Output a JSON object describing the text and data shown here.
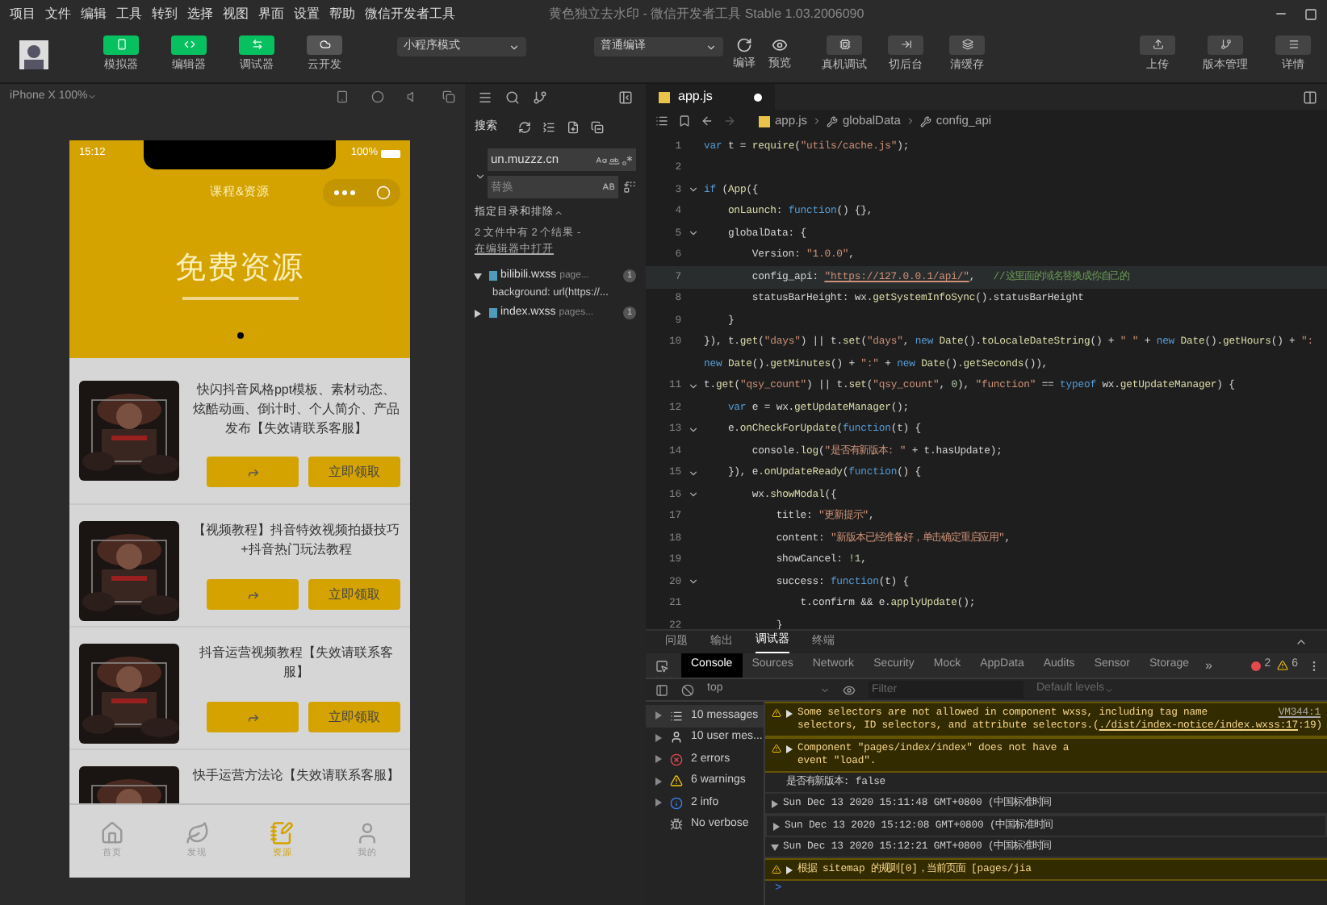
{
  "menu": [
    "项目",
    "文件",
    "编辑",
    "工具",
    "转到",
    "选择",
    "视图",
    "界面",
    "设置",
    "帮助",
    "微信开发者工具"
  ],
  "window": {
    "title": "黄色独立去水印 - 微信开发者工具 Stable 1.03.2006090"
  },
  "toolbar": {
    "views": [
      {
        "label": "模拟器",
        "kind": "phone",
        "on": true
      },
      {
        "label": "编辑器",
        "kind": "code",
        "on": true
      },
      {
        "label": "调试器",
        "kind": "debug",
        "on": true
      },
      {
        "label": "云开发",
        "kind": "cloud",
        "on": false
      }
    ],
    "mode": "小程序模式",
    "compile": "普通编译",
    "actions": [
      {
        "label": "编译",
        "kind": "refresh"
      },
      {
        "label": "预览",
        "kind": "eye"
      }
    ],
    "tools": [
      {
        "label": "真机调试",
        "kind": "device"
      },
      {
        "label": "切后台",
        "kind": "background"
      },
      {
        "label": "清缓存",
        "kind": "cache"
      }
    ],
    "right": [
      {
        "label": "上传",
        "kind": "upload"
      },
      {
        "label": "版本管理",
        "kind": "branch"
      },
      {
        "label": "详情",
        "kind": "details"
      }
    ]
  },
  "simulator": {
    "device": "iPhone X 100%",
    "time": "15:12",
    "battery": "100%",
    "nav_title": "课程&资源",
    "banner_title": "免费资源",
    "items": [
      {
        "title": "快闪抖音风格ppt模板、素材动态、炫酷动画、倒计时、个人简介、产品发布【失效请联系客服】",
        "button": "立即领取"
      },
      {
        "title": "【视频教程】抖音特效视频拍摄技巧+抖音热门玩法教程",
        "button": "立即领取"
      },
      {
        "title": "抖音运营视频教程【失效请联系客服】",
        "button": "立即领取"
      },
      {
        "title": "快手运营方法论【失效请联系客服】"
      }
    ],
    "tabs": [
      {
        "label": "首页",
        "kind": "home",
        "selected": false
      },
      {
        "label": "发现",
        "kind": "discover",
        "selected": false
      },
      {
        "label": "资源",
        "kind": "resource",
        "selected": true
      },
      {
        "label": "我的",
        "kind": "me",
        "selected": false
      }
    ]
  },
  "search": {
    "title": "搜索",
    "query": "un.muzzz.cn",
    "replace_placeholder": "替换",
    "scope": "指定目录和排除",
    "summary": "2 文件中有 2 个结果 - ",
    "open_link": "在编辑器中打开",
    "results": [
      {
        "file": "bilibili.wxss",
        "path": "page...",
        "count": "1",
        "expanded": true,
        "children": [
          {
            "text": "background: url(https://..."
          }
        ]
      },
      {
        "file": "index.wxss",
        "path": "pages...",
        "count": "1",
        "expanded": false
      }
    ]
  },
  "editor": {
    "tab": "app.js",
    "modified": true,
    "breadcrumb": [
      "app.js",
      "globalData",
      "config_api"
    ],
    "lines": [
      {
        "n": "1",
        "fold": false,
        "current": false,
        "tokens": [
          {
            "text": "var ",
            "kind": "kw"
          },
          {
            "text": "t = ",
            "kind": "p"
          },
          {
            "text": "require",
            "kind": "fn"
          },
          {
            "text": "(",
            "kind": "p"
          },
          {
            "text": "\"utils/cache.js\"",
            "kind": "str"
          },
          {
            "text": ");",
            "kind": "p"
          }
        ]
      },
      {
        "n": "2",
        "fold": false,
        "current": false
      },
      {
        "n": "3",
        "fold": true,
        "current": false,
        "tokens": [
          {
            "text": "if ",
            "kind": "kw"
          },
          {
            "text": "(",
            "kind": "p"
          },
          {
            "text": "App",
            "kind": "fn"
          },
          {
            "text": "({",
            "kind": "p"
          }
        ]
      },
      {
        "n": "4",
        "fold": false,
        "current": false,
        "tokens": [
          {
            "text": "    onLaunch",
            "kind": "fn"
          },
          {
            "text": ": ",
            "kind": "p"
          },
          {
            "text": "function",
            "kind": "kw"
          },
          {
            "text": "() {},",
            "kind": "p"
          }
        ]
      },
      {
        "n": "5",
        "fold": true,
        "current": false,
        "tokens": [
          {
            "text": "    globalData: {",
            "kind": "p"
          }
        ]
      },
      {
        "n": "6",
        "fold": false,
        "current": false,
        "tokens": [
          {
            "text": "        Version: ",
            "kind": "p"
          },
          {
            "text": "\"1.0.0\"",
            "kind": "str"
          },
          {
            "text": ",",
            "kind": "p"
          }
        ]
      },
      {
        "n": "7",
        "fold": false,
        "current": true,
        "tokens": [
          {
            "text": "        config_api: ",
            "kind": "p"
          },
          {
            "text": "\"https://127.0.0.1/api/\"",
            "kind": "url"
          },
          {
            "text": ",   ",
            "kind": "p"
          },
          {
            "text": "//这里面的域名替换成你自己的",
            "kind": "cmt"
          }
        ]
      },
      {
        "n": "8",
        "fold": false,
        "current": false,
        "tokens": [
          {
            "text": "        statusBarHeight: wx.",
            "kind": "p"
          },
          {
            "text": "getSystemInfoSync",
            "kind": "fn"
          },
          {
            "text": "().statusBarHeight",
            "kind": "p"
          }
        ]
      },
      {
        "n": "9",
        "fold": false,
        "current": false,
        "tokens": [
          {
            "text": "    }",
            "kind": "p"
          }
        ]
      },
      {
        "n": "10",
        "fold": false,
        "current": false,
        "tokens": [
          {
            "text": "}), t.",
            "kind": "p"
          },
          {
            "text": "get",
            "kind": "fn"
          },
          {
            "text": "(",
            "kind": "p"
          },
          {
            "text": "\"days\"",
            "kind": "str"
          },
          {
            "text": ") || t.",
            "kind": "p"
          },
          {
            "text": "set",
            "kind": "fn"
          },
          {
            "text": "(",
            "kind": "p"
          },
          {
            "text": "\"days\"",
            "kind": "str"
          },
          {
            "text": ", ",
            "kind": "p"
          },
          {
            "text": "new ",
            "kind": "kw"
          },
          {
            "text": "Date",
            "kind": "fn"
          },
          {
            "text": "().",
            "kind": "p"
          },
          {
            "text": "toLocaleDateString",
            "kind": "fn"
          },
          {
            "text": "() + ",
            "kind": "p"
          },
          {
            "text": "\" \"",
            "kind": "str"
          },
          {
            "text": " + ",
            "kind": "p"
          },
          {
            "text": "new ",
            "kind": "kw"
          },
          {
            "text": "Date",
            "kind": "fn"
          },
          {
            "text": "().",
            "kind": "p"
          },
          {
            "text": "getHours",
            "kind": "fn"
          },
          {
            "text": "() + ",
            "kind": "p"
          },
          {
            "text": "\":",
            "kind": "str"
          }
        ]
      },
      {
        "fold": false,
        "current": false,
        "tokens": [
          {
            "text": "new ",
            "kind": "kw"
          },
          {
            "text": "Date",
            "kind": "fn"
          },
          {
            "text": "().",
            "kind": "p"
          },
          {
            "text": "getMinutes",
            "kind": "fn"
          },
          {
            "text": "() + ",
            "kind": "p"
          },
          {
            "text": "\":\"",
            "kind": "str"
          },
          {
            "text": " + ",
            "kind": "p"
          },
          {
            "text": "new ",
            "kind": "kw"
          },
          {
            "text": "Date",
            "kind": "fn"
          },
          {
            "text": "().",
            "kind": "p"
          },
          {
            "text": "getSeconds",
            "kind": "fn"
          },
          {
            "text": "()),",
            "kind": "p"
          }
        ]
      },
      {
        "n": "11",
        "fold": true,
        "current": false,
        "tokens": [
          {
            "text": "t.",
            "kind": "p"
          },
          {
            "text": "get",
            "kind": "fn"
          },
          {
            "text": "(",
            "kind": "p"
          },
          {
            "text": "\"qsy_count\"",
            "kind": "str"
          },
          {
            "text": ") || t.",
            "kind": "p"
          },
          {
            "text": "set",
            "kind": "fn"
          },
          {
            "text": "(",
            "kind": "p"
          },
          {
            "text": "\"qsy_count\"",
            "kind": "str"
          },
          {
            "text": ", ",
            "kind": "p"
          },
          {
            "text": "0",
            "kind": "num"
          },
          {
            "text": "), ",
            "kind": "p"
          },
          {
            "text": "\"function\"",
            "kind": "str"
          },
          {
            "text": " == ",
            "kind": "p"
          },
          {
            "text": "typeof ",
            "kind": "kw"
          },
          {
            "text": "wx.",
            "kind": "p"
          },
          {
            "text": "getUpdateManager",
            "kind": "fn"
          },
          {
            "text": ") {",
            "kind": "p"
          }
        ]
      },
      {
        "n": "12",
        "fold": false,
        "current": false,
        "tokens": [
          {
            "text": "    var ",
            "kind": "kw"
          },
          {
            "text": "e = wx.",
            "kind": "p"
          },
          {
            "text": "getUpdateManager",
            "kind": "fn"
          },
          {
            "text": "();",
            "kind": "p"
          }
        ]
      },
      {
        "n": "13",
        "fold": true,
        "current": false,
        "tokens": [
          {
            "text": "    e.",
            "kind": "p"
          },
          {
            "text": "onCheckForUpdate",
            "kind": "fn"
          },
          {
            "text": "(",
            "kind": "p"
          },
          {
            "text": "function",
            "kind": "kw"
          },
          {
            "text": "(t) {",
            "kind": "p"
          }
        ]
      },
      {
        "n": "14",
        "fold": false,
        "current": false,
        "tokens": [
          {
            "text": "        console.",
            "kind": "p"
          },
          {
            "text": "log",
            "kind": "fn"
          },
          {
            "text": "(",
            "kind": "p"
          },
          {
            "text": "\"是否有新版本: \"",
            "kind": "str"
          },
          {
            "text": " + t.hasUpdate);",
            "kind": "p"
          }
        ]
      },
      {
        "n": "15",
        "fold": true,
        "current": false,
        "tokens": [
          {
            "text": "    }), e.",
            "kind": "p"
          },
          {
            "text": "onUpdateReady",
            "kind": "fn"
          },
          {
            "text": "(",
            "kind": "p"
          },
          {
            "text": "function",
            "kind": "kw"
          },
          {
            "text": "() {",
            "kind": "p"
          }
        ]
      },
      {
        "n": "16",
        "fold": true,
        "current": false,
        "tokens": [
          {
            "text": "        wx.",
            "kind": "p"
          },
          {
            "text": "showModal",
            "kind": "fn"
          },
          {
            "text": "({",
            "kind": "p"
          }
        ]
      },
      {
        "n": "17",
        "fold": false,
        "current": false,
        "tokens": [
          {
            "text": "            title: ",
            "kind": "p"
          },
          {
            "text": "\"更新提示\"",
            "kind": "str"
          },
          {
            "text": ",",
            "kind": "p"
          }
        ]
      },
      {
        "n": "18",
        "fold": false,
        "current": false,
        "tokens": [
          {
            "text": "            content: ",
            "kind": "p"
          },
          {
            "text": "\"新版本已经准备好，单击确定重启应用\"",
            "kind": "str"
          },
          {
            "text": ",",
            "kind": "p"
          }
        ]
      },
      {
        "n": "19",
        "fold": false,
        "current": false,
        "tokens": [
          {
            "text": "            showCancel: ",
            "kind": "p"
          },
          {
            "text": "!1",
            "kind": "num"
          },
          {
            "text": ",",
            "kind": "p"
          }
        ]
      },
      {
        "n": "20",
        "fold": true,
        "current": false,
        "tokens": [
          {
            "text": "            success: ",
            "kind": "p"
          },
          {
            "text": "function",
            "kind": "kw"
          },
          {
            "text": "(t) {",
            "kind": "p"
          }
        ]
      },
      {
        "n": "21",
        "fold": false,
        "current": false,
        "tokens": [
          {
            "text": "                t.confirm && e.",
            "kind": "p"
          },
          {
            "text": "applyUpdate",
            "kind": "fn"
          },
          {
            "text": "();",
            "kind": "p"
          }
        ]
      },
      {
        "n": "22",
        "fold": false,
        "current": false,
        "tokens": [
          {
            "text": "            }",
            "kind": "p"
          }
        ]
      }
    ]
  },
  "debug": {
    "panel_tabs": [
      {
        "label": "问题",
        "selected": false
      },
      {
        "label": "输出",
        "selected": false
      },
      {
        "label": "调试器",
        "selected": true
      },
      {
        "label": "终端",
        "selected": false
      }
    ],
    "tabs": [
      {
        "label": "Console",
        "selected": true
      },
      {
        "label": "Sources",
        "selected": false
      },
      {
        "label": "Network",
        "selected": false
      },
      {
        "label": "Security",
        "selected": false
      },
      {
        "label": "Mock",
        "selected": false
      },
      {
        "label": "AppData",
        "selected": false
      },
      {
        "label": "Audits",
        "selected": false
      },
      {
        "label": "Sensor",
        "selected": false
      },
      {
        "label": "Storage",
        "selected": false
      }
    ],
    "more": "»",
    "errors": "2",
    "warnings": "6",
    "context": "top",
    "filter_placeholder": "Filter",
    "levels": "Default levels",
    "sidebar": [
      {
        "label": "10 messages",
        "kind": "list",
        "selected": true
      },
      {
        "label": "10 user mes...",
        "kind": "user",
        "selected": false
      },
      {
        "label": "2 errors",
        "kind": "error",
        "selected": false
      },
      {
        "label": "6 warnings",
        "kind": "warning",
        "selected": false
      },
      {
        "label": "2 info",
        "kind": "info",
        "selected": false
      },
      {
        "label": "No verbose",
        "kind": "verbose",
        "selected": false
      }
    ],
    "messages": [
      {
        "kind": "warning",
        "lines": [
          "Some selectors are not allowed in component wxss, including tag name"
        ],
        "tail": "selectors, ID selectors, and attribute selectors.(",
        "link": "./dist/index-notice/index.wxss:17",
        "after": ":19)",
        "source": "VM344:1"
      },
      {
        "kind": "warning",
        "lines": [
          "Component \"pages/index/index\" does not have a",
          "event \"load\"."
        ]
      },
      {
        "kind": "log",
        "lines": [
          "是否有新版本: false"
        ]
      },
      {
        "kind": "group",
        "expanded": false,
        "selected": false,
        "lines": [
          "Sun Dec 13 2020 15:11:48 GMT+0800 (中国标准时间"
        ]
      },
      {
        "kind": "group",
        "expanded": false,
        "selected": true,
        "lines": [
          "Sun Dec 13 2020 15:12:08 GMT+0800 (中国标准时间"
        ]
      },
      {
        "kind": "group",
        "expanded": true,
        "selected": false,
        "lines": [
          "Sun Dec 13 2020 15:12:21 GMT+0800 (中国标准时间"
        ]
      },
      {
        "kind": "warning",
        "lines": [
          "根据 sitemap 的规则[0]，当前页面 [pages/jia"
        ]
      }
    ],
    "prompt": ">"
  }
}
